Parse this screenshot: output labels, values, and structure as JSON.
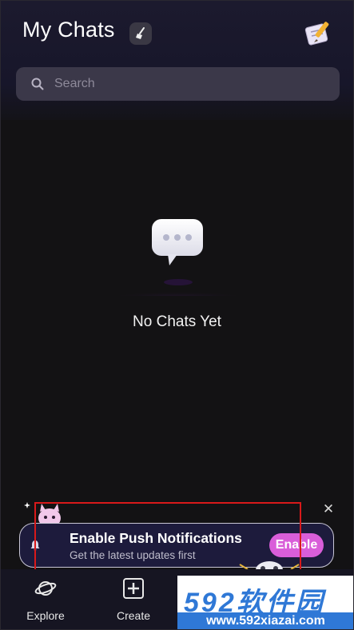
{
  "header": {
    "title": "My Chats",
    "clean_icon": "broom-icon",
    "compose_icon": "compose-icon"
  },
  "search": {
    "placeholder": "Search",
    "icon": "search-icon"
  },
  "empty_state": {
    "icon": "chat-bubble-icon",
    "text": "No Chats Yet"
  },
  "notification": {
    "title": "Enable Push Notifications",
    "subtitle": "Get the latest updates first",
    "button": "Enable",
    "close_icon": "close-icon",
    "close_glyph": "✕"
  },
  "tabs": [
    {
      "label": "Explore",
      "icon": "planet-icon"
    },
    {
      "label": "Create",
      "icon": "plus-square-icon"
    }
  ],
  "watermark": {
    "brand": "592软件园",
    "url": "www.592xiazai.com"
  },
  "colors": {
    "background": "#131214",
    "search_bg": "#3b3849",
    "accent": "#d95ed9",
    "highlight_box": "#d8191a"
  }
}
